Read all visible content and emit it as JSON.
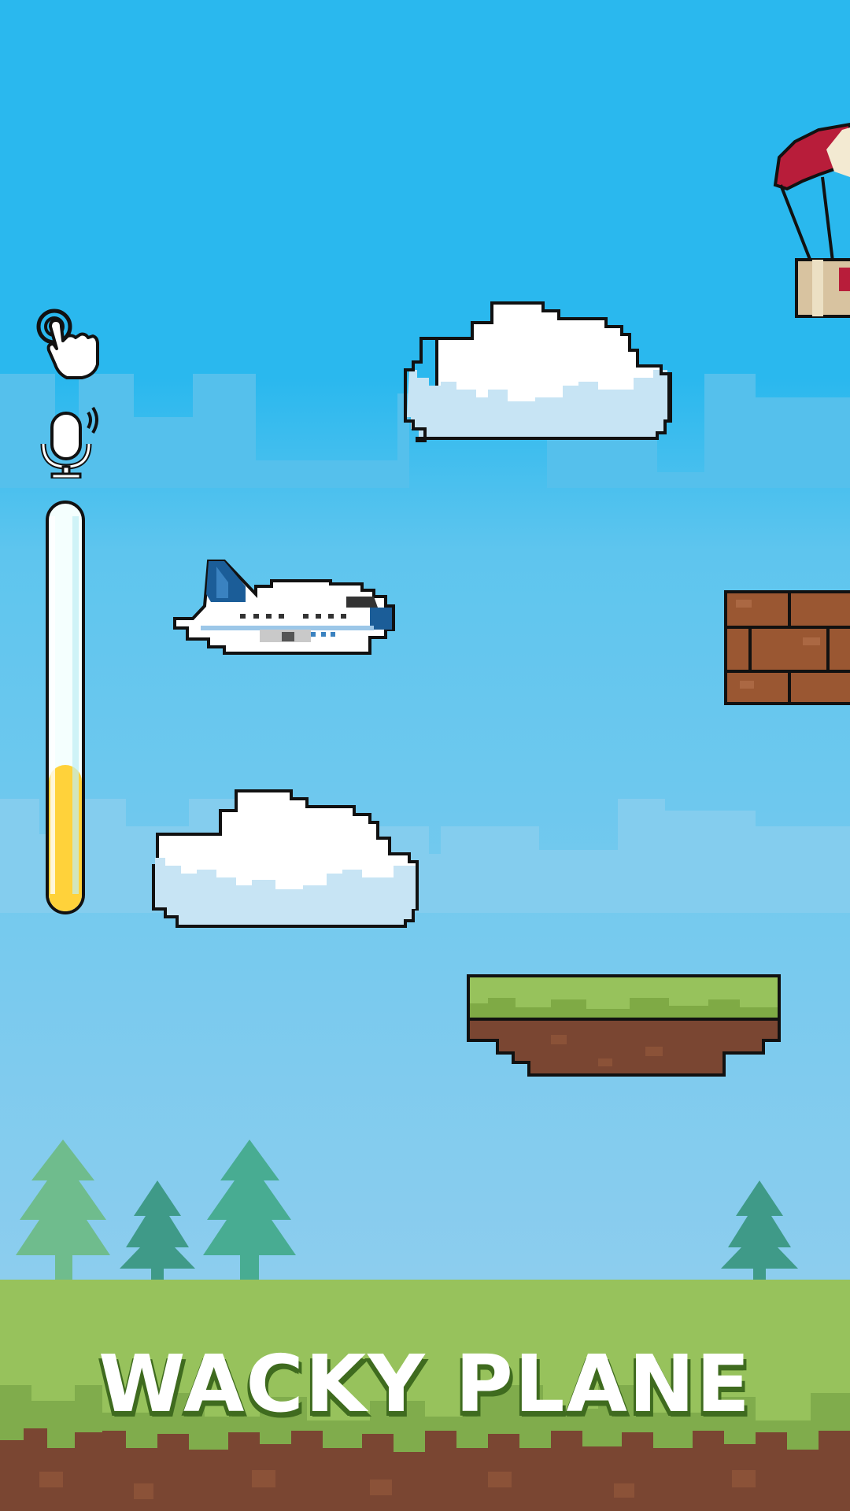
{
  "game": {
    "title": "WACKY PLANE"
  },
  "hud": {
    "controls": [
      {
        "name": "tap-control",
        "icon": "tap-hand-icon"
      },
      {
        "name": "voice-control",
        "icon": "microphone-icon"
      }
    ],
    "voice_level": 0.36
  },
  "colors": {
    "sky": "#2ab8ee",
    "meter_fill": "#ffd23a",
    "meter_empty": "#f4fffe",
    "grass": "#97c25c",
    "dirt": "#7a4632",
    "brick": "#9a5732",
    "parachute": "#b81d3a",
    "plane_tail": "#1b5d98"
  }
}
